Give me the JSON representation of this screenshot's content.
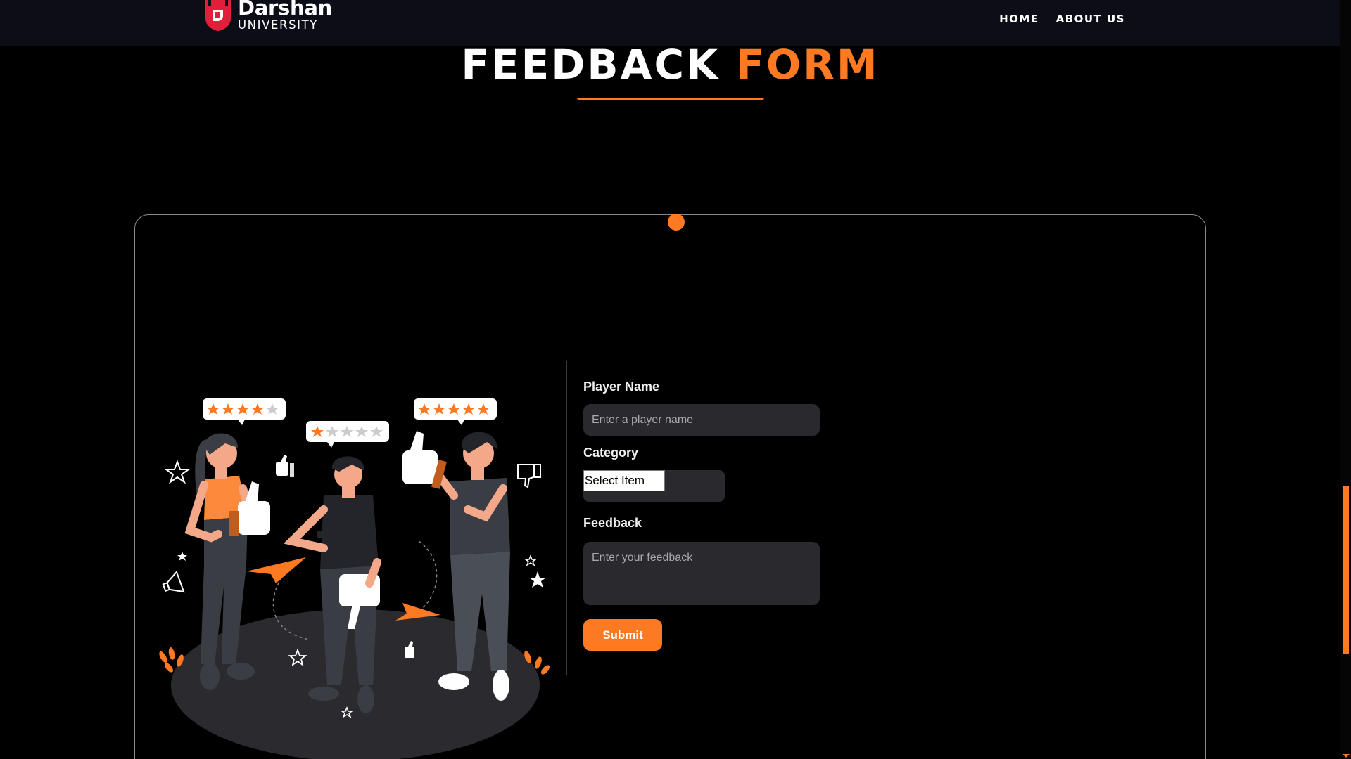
{
  "header": {
    "logo_title": "Darshan",
    "logo_subtitle": "UNIVERSITY",
    "nav": [
      {
        "label": "HOME"
      },
      {
        "label": "ABOUT US"
      }
    ]
  },
  "heading": {
    "word1": "FEEDBACK",
    "word2": "FORM"
  },
  "form": {
    "player_name_label": "Player Name",
    "player_name_placeholder": "Enter a player name",
    "player_name_value": "",
    "category_label": "Category",
    "category_selected": "Select Item",
    "feedback_label": "Feedback",
    "feedback_placeholder": "Enter your feedback",
    "feedback_value": "",
    "submit_label": "Submit"
  },
  "colors": {
    "accent": "#fd7a22",
    "background": "#000000",
    "header_bg": "#0c0d16",
    "input_bg": "#2a2a2e",
    "logo_red": "#e0203a"
  },
  "illustration": {
    "ratings": [
      4,
      1,
      5
    ],
    "icons": [
      "thumbs-up-icon",
      "thumbs-down-icon",
      "star-icon",
      "megaphone-icon",
      "paper-plane-icon"
    ]
  }
}
